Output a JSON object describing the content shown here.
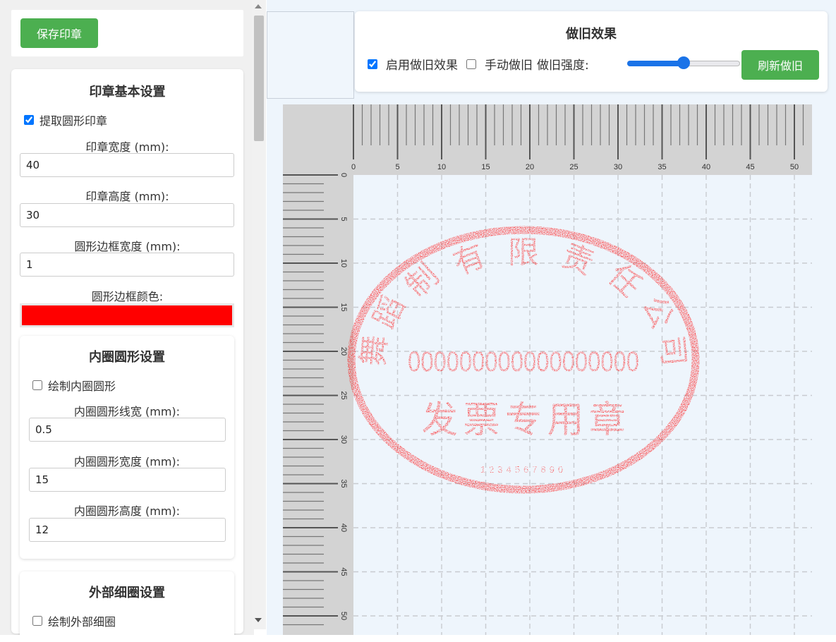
{
  "save_button": "保存印章",
  "basic": {
    "title": "印章基本设置",
    "extract_circle": "提取圆形印章",
    "width_label": "印章宽度 (mm):",
    "width_value": "40",
    "height_label": "印章高度 (mm):",
    "height_value": "30",
    "border_width_label": "圆形边框宽度 (mm):",
    "border_width_value": "1",
    "border_color_label": "圆形边框颜色:",
    "border_color": "#ff0000"
  },
  "inner": {
    "title": "内圈圆形设置",
    "draw_inner": "绘制内圈圆形",
    "line_width_label": "内圈圆形线宽 (mm):",
    "line_width_value": "0.5",
    "width_label": "内圈圆形宽度 (mm):",
    "width_value": "15",
    "height_label": "内圈圆形高度 (mm):",
    "height_value": "12"
  },
  "outer": {
    "title": "外部细圈设置",
    "draw_outer": "绘制外部细圈"
  },
  "aging": {
    "title": "做旧效果",
    "enable_label": "启用做旧效果",
    "manual_label": "手动做旧",
    "strength_label": "做旧强度:",
    "strength_fraction": 0.5,
    "refresh_button": "刷新做旧"
  },
  "ruler": {
    "top_ticks": [
      "0",
      "5",
      "10",
      "15",
      "20",
      "25",
      "30",
      "35",
      "40",
      "45",
      "50"
    ],
    "left_ticks": [
      "0",
      "5",
      "10",
      "15",
      "20",
      "25",
      "30",
      "35",
      "40",
      "45",
      "50"
    ]
  },
  "stamp": {
    "company_chars": [
      "舞",
      "蹈",
      "制",
      "有",
      "限",
      "责",
      "任",
      "公",
      "司"
    ],
    "tax_number": "000000000000000000",
    "type_text": "发票专用章",
    "code_text": "1234567890",
    "color": "#ff0000"
  }
}
